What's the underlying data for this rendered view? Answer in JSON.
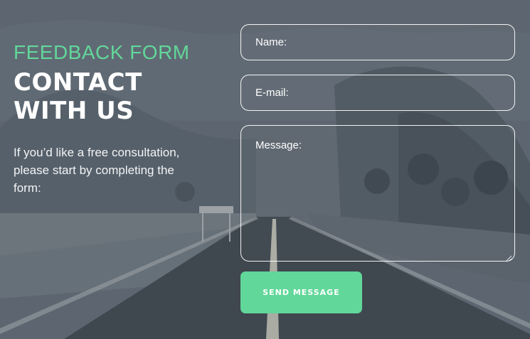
{
  "colors": {
    "accent": "#62d79a",
    "overlay": "#5d6670",
    "text": "#ffffff"
  },
  "header": {
    "eyebrow": "FEEDBACK FORM",
    "headline_line1": "CONTACT",
    "headline_line2": "WITH US",
    "intro": "If you’d like a free consultation, please start by completing the form:"
  },
  "form": {
    "name_placeholder": "Name:",
    "email_placeholder": "E-mail:",
    "message_placeholder": "Message:",
    "submit_label": "SEND MESSAGE"
  },
  "icons": {
    "resize": "resize-grip-icon"
  }
}
